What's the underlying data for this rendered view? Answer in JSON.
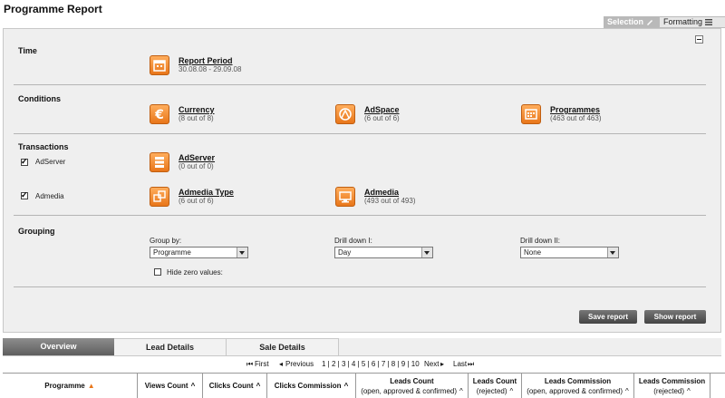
{
  "page": {
    "title": "Programme Report"
  },
  "top_tabs": {
    "selection": "Selection",
    "formatting": "Formatting"
  },
  "sections": {
    "time": {
      "title": "Time"
    },
    "conditions": {
      "title": "Conditions"
    },
    "transactions": {
      "title": "Transactions"
    },
    "grouping": {
      "title": "Grouping"
    }
  },
  "time": {
    "report_period": {
      "label": "Report Period",
      "value": "30.08.08 - 29.09.08"
    }
  },
  "conditions": {
    "currency": {
      "label": "Currency",
      "count": "(8 out of 8)"
    },
    "adspace": {
      "label": "AdSpace",
      "count": "(6 out of 6)"
    },
    "programmes": {
      "label": "Programmes",
      "count": "(463 out of 463)"
    }
  },
  "transactions": {
    "adserver_cb": "AdServer",
    "admedia_cb": "Admedia",
    "adserver": {
      "label": "AdServer",
      "count": "(0 out of 0)"
    },
    "admedia_type": {
      "label": "Admedia Type",
      "count": "(6 out of 6)"
    },
    "admedia": {
      "label": "Admedia",
      "count": "(493 out of 493)"
    }
  },
  "grouping": {
    "group_by": {
      "label": "Group by:",
      "value": "Programme"
    },
    "drill1": {
      "label": "Drill down I:",
      "value": "Day"
    },
    "drill2": {
      "label": "Drill down II:",
      "value": "None"
    },
    "hide_zero": "Hide zero values:"
  },
  "buttons": {
    "save": "Save report",
    "show": "Show report"
  },
  "report_tabs": [
    "Overview",
    "Lead Details",
    "Sale Details"
  ],
  "pager": {
    "first": "First",
    "previous": "Previous",
    "pages": "1 | 2 | 3 | 4 | 5 | 6 | 7 | 8 | 9 | 10",
    "next": "Next",
    "last": "Last"
  },
  "columns": [
    {
      "line1": "Programme",
      "line2": ""
    },
    {
      "line1": "Views Count",
      "line2": ""
    },
    {
      "line1": "Clicks Count",
      "line2": ""
    },
    {
      "line1": "Clicks Commission",
      "line2": ""
    },
    {
      "line1": "Leads Count",
      "line2": "(open, approved & confirmed)"
    },
    {
      "line1": "Leads Count",
      "line2": "(rejected)"
    },
    {
      "line1": "Leads Commission",
      "line2": "(open, approved & confirmed)"
    },
    {
      "line1": "Leads Commission",
      "line2": "(rejected)"
    }
  ],
  "colors": {
    "accent": "#e8761a",
    "panel": "#efefef",
    "tab_active": "#6a6a6a"
  }
}
